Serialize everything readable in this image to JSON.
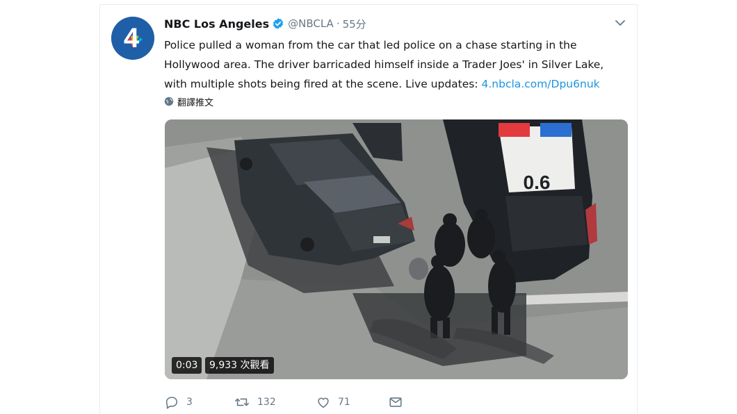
{
  "tweet": {
    "author_name": "NBC Los Angeles",
    "handle": "@NBCLA",
    "separator": "·",
    "time": "55分",
    "text": "Police pulled a woman from the car that led police on a chase starting in the Hollywood area. The driver barricaded himself inside a Trader Joes' in Silver Lake, with multiple shots being fired at the scene. Live updates: ",
    "link": "4.nbcla.com/Dpu6nuk",
    "translate_label": "翻譯推文",
    "avatar": {
      "text": "4"
    },
    "video": {
      "time": "0:03",
      "views": "9,933 次觀看",
      "car_plate_text": "0.6"
    },
    "actions": {
      "replies": "3",
      "retweets": "132",
      "likes": "71"
    }
  },
  "colors": {
    "link": "#1b95e0",
    "secondary_text": "#657786",
    "verified": "#1da1f2",
    "avatar_bg": "#1f5fa8"
  },
  "icons": [
    "verified-icon",
    "caret-down-icon",
    "globe-icon",
    "reply-icon",
    "retweet-icon",
    "like-icon",
    "message-icon"
  ]
}
